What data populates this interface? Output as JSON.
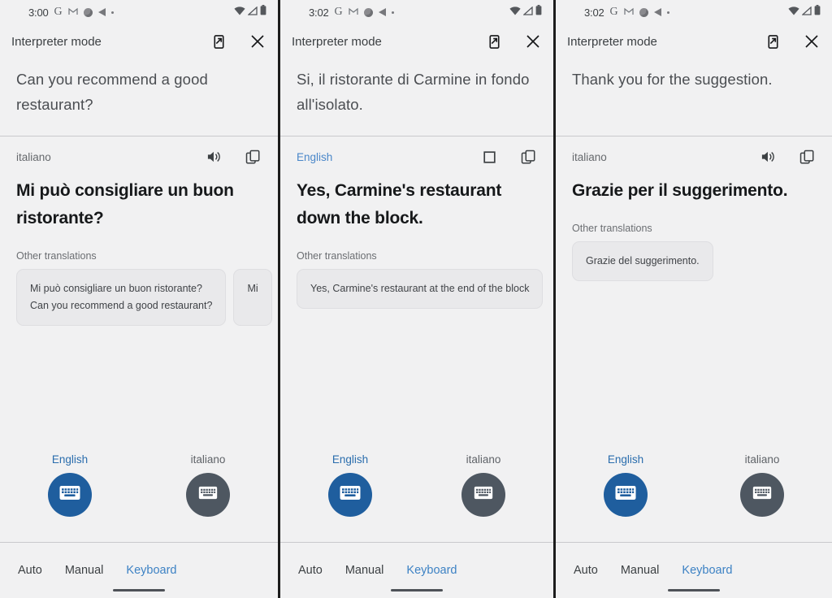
{
  "accent": {
    "blue_link": "#3d82c4",
    "blue_fab": "#1f5e9e",
    "gray_fab": "#4e5761",
    "text_dark": "#16181a",
    "text_muted": "#66696d",
    "panel_bg": "#f1f1f2"
  },
  "app": {
    "title": "Interpreter mode",
    "cast_icon": "cast-to-phone-icon",
    "close_icon": "close-icon",
    "speaker_icon": "speaker-icon",
    "stop_icon": "stop-square-icon",
    "copy_icon": "copy-icon",
    "keyboard_icon": "keyboard-icon",
    "wifi_icon": "wifi-icon",
    "signal_icon": "signal-icon",
    "battery_icon": "battery-icon",
    "google_icon": "google-g-icon",
    "gmail_icon": "gmail-icon",
    "photos_icon": "photos-icon",
    "play_icon": "play-triangle-icon",
    "dot_icon": "dot-icon"
  },
  "modes": {
    "auto": "Auto",
    "manual": "Manual",
    "keyboard": "Keyboard",
    "active": "Keyboard"
  },
  "panels": [
    {
      "status_time": "3:00",
      "source_text": "Can you recommend a good restaurant?",
      "target_lang": "italiano",
      "target_lang_accent": false,
      "audio_state": "speaker",
      "translation": "Mi può consigliare un buon ristorante?",
      "other_label": "Other translations",
      "alternatives": [
        {
          "lines": [
            "Mi può consigliare un buon ristorante?",
            "Can you recommend a good restaurant?"
          ],
          "partial": false
        },
        {
          "lines": [
            "Mi"
          ],
          "partial": true
        }
      ],
      "left_lang": "English",
      "right_lang": "italiano"
    },
    {
      "status_time": "3:02",
      "source_text": "Si, il ristorante di Carmine in fondo all'isolato.",
      "target_lang": "English",
      "target_lang_accent": true,
      "audio_state": "stop",
      "translation": "Yes, Carmine's restaurant down the block.",
      "other_label": "Other translations",
      "alternatives": [
        {
          "lines": [
            "Yes, Carmine's restaurant at the end of the block"
          ],
          "partial": false
        }
      ],
      "left_lang": "English",
      "right_lang": "italiano"
    },
    {
      "status_time": "3:02",
      "source_text": "Thank you for the suggestion.",
      "target_lang": "italiano",
      "target_lang_accent": false,
      "audio_state": "speaker",
      "translation": "Grazie per il suggerimento.",
      "other_label": "Other translations",
      "alternatives": [
        {
          "lines": [
            "Grazie del suggerimento."
          ],
          "partial": false
        }
      ],
      "left_lang": "English",
      "right_lang": "italiano"
    }
  ]
}
